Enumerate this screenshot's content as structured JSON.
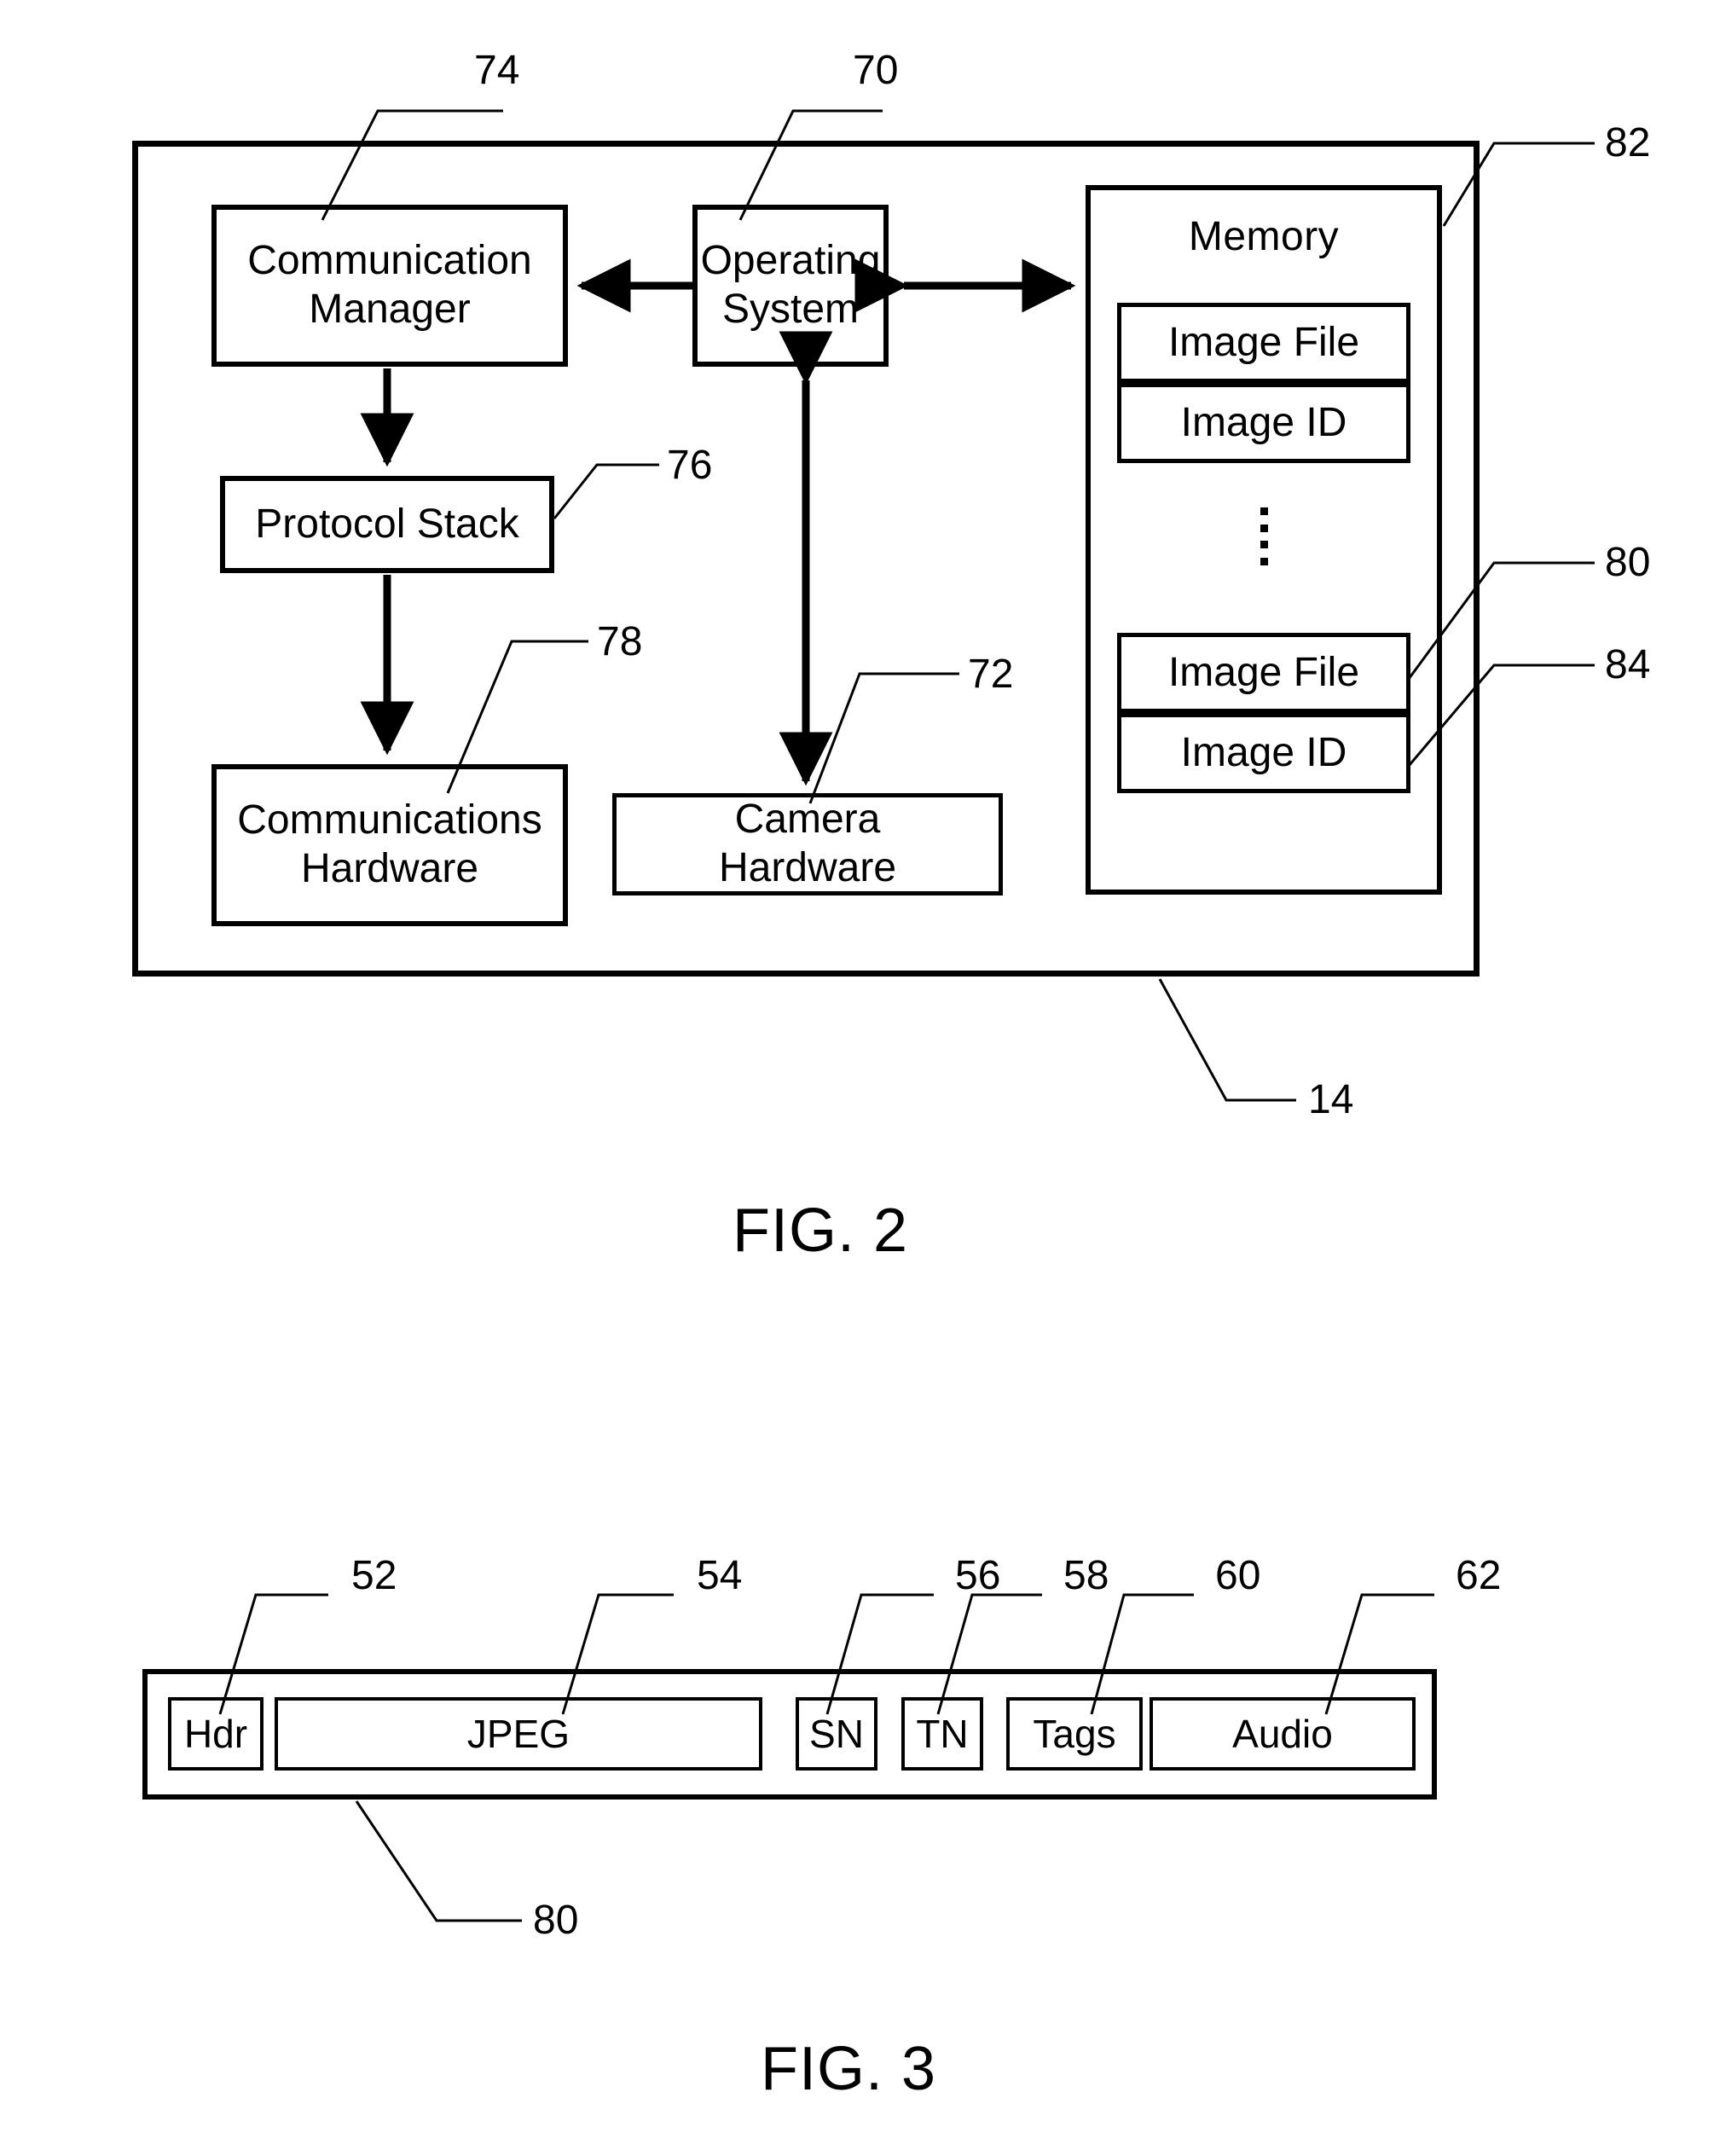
{
  "document": {
    "type": "patent-drawing-sheet",
    "figures": [
      "FIG. 2",
      "FIG. 3"
    ]
  },
  "fig2": {
    "caption": "FIG. 2",
    "device_ref": "14",
    "blocks": {
      "communication_manager": "Communication\nManager",
      "communication_manager_l1": "Communication",
      "communication_manager_l2": "Manager",
      "operating_system_l1": "Operating",
      "operating_system_l2": "System",
      "protocol_stack": "Protocol Stack",
      "communications_hardware_l1": "Communications",
      "communications_hardware_l2": "Hardware",
      "camera_hardware_l1": "Camera",
      "camera_hardware_l2": "Hardware",
      "memory": "Memory",
      "image_file_top": "Image File",
      "image_id_top": "Image ID",
      "image_file_bottom": "Image File",
      "image_id_bottom": "Image ID"
    },
    "refs": {
      "communication_manager": "74",
      "operating_system": "70",
      "protocol_stack": "76",
      "communications_hardware": "78",
      "camera_hardware": "72",
      "memory": "82",
      "image_file": "80",
      "image_id": "84",
      "device": "14"
    }
  },
  "fig3": {
    "caption": "FIG. 3",
    "file_ref": "80",
    "segments": [
      {
        "label": "Hdr",
        "ref": "52"
      },
      {
        "label": "JPEG",
        "ref": "54"
      },
      {
        "label": "SN",
        "ref": "56"
      },
      {
        "label": "TN",
        "ref": "58"
      },
      {
        "label": "Tags",
        "ref": "60"
      },
      {
        "label": "Audio",
        "ref": "62"
      }
    ]
  }
}
